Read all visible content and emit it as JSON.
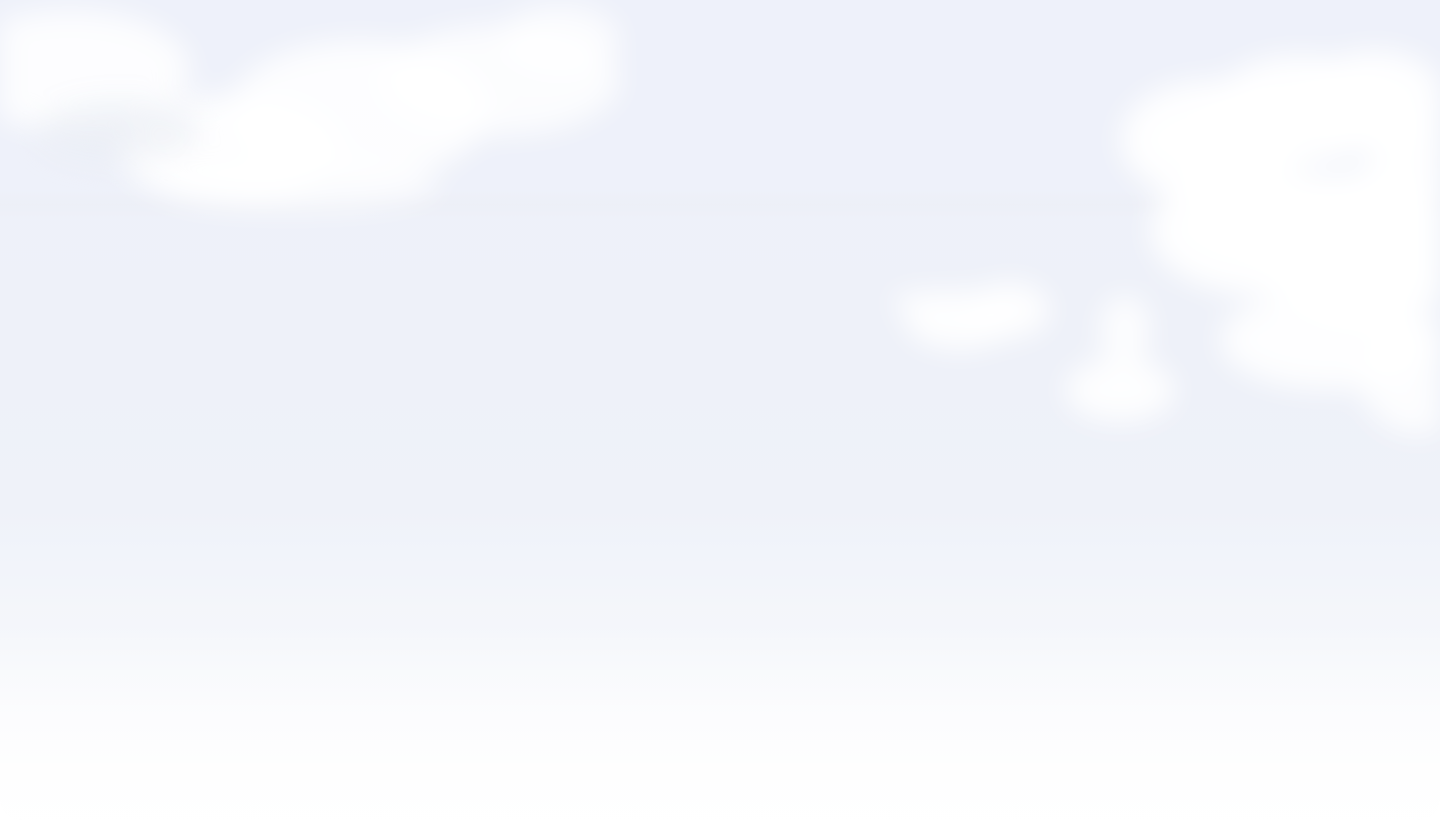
{
  "scene": {
    "background": {
      "sky_top": "#eef1fa",
      "sky_mid": "#eff2f9",
      "sky_bottom": "#fefefe",
      "cloud_color": "#ffffff"
    },
    "text": []
  }
}
